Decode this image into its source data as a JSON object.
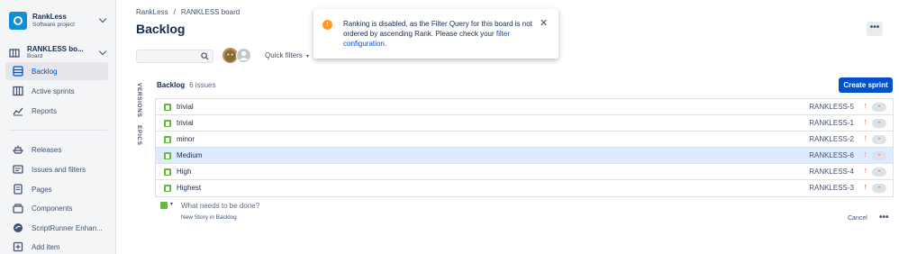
{
  "sidebar": {
    "project_name": "RankLess",
    "project_type": "Software project",
    "board_name": "RANKLESS bo...",
    "board_type": "Board",
    "items": [
      {
        "label": "Backlog",
        "icon": "backlog-icon"
      },
      {
        "label": "Active sprints",
        "icon": "columns-icon"
      },
      {
        "label": "Reports",
        "icon": "chart-icon"
      },
      {
        "label": "Releases",
        "icon": "ship-icon"
      },
      {
        "label": "Issues and filters",
        "icon": "issues-icon"
      },
      {
        "label": "Pages",
        "icon": "page-icon"
      },
      {
        "label": "Components",
        "icon": "components-icon"
      },
      {
        "label": "ScriptRunner Enhan...",
        "icon": "scriptrunner-icon"
      },
      {
        "label": "Add item",
        "icon": "add-icon"
      }
    ]
  },
  "header": {
    "breadcrumb_1": "RankLess",
    "breadcrumb_sep": "/",
    "breadcrumb_2": "RANKLESS board",
    "title": "Backlog",
    "more": "•••"
  },
  "toolbar": {
    "quick_filters": "Quick filters"
  },
  "flag": {
    "message": "Ranking is disabled, as the Filter Query for this board is not ordered by ascending Rank. Please check your ",
    "link": "filter configuration",
    "end": "."
  },
  "side_tabs": {
    "versions": "VERSIONS",
    "epics": "EPICS"
  },
  "backlog": {
    "name": "Backlog",
    "count": "6 issues",
    "create_sprint": "Create sprint",
    "issues": [
      {
        "summary": "trivial",
        "key": "RANKLESS-5",
        "estimate": "-"
      },
      {
        "summary": "trivial",
        "key": "RANKLESS-1",
        "estimate": "-"
      },
      {
        "summary": "minor",
        "key": "RANKLESS-2",
        "estimate": "-"
      },
      {
        "summary": "Medium",
        "key": "RANKLESS-6",
        "estimate": "-"
      },
      {
        "summary": "High",
        "key": "RANKLESS-4",
        "estimate": "-"
      },
      {
        "summary": "Highest",
        "key": "RANKLESS-3",
        "estimate": "-"
      }
    ],
    "selected_index": 3,
    "create_placeholder": "What needs to be done?",
    "create_hint": "New Story in Backlog",
    "cancel": "Cancel",
    "more": "•••"
  },
  "colors": {
    "accent": "#0052cc",
    "story": "#63ba3c",
    "warning": "#ff991f",
    "priority_up": "#ff5630",
    "selected_row": "#deebff"
  }
}
